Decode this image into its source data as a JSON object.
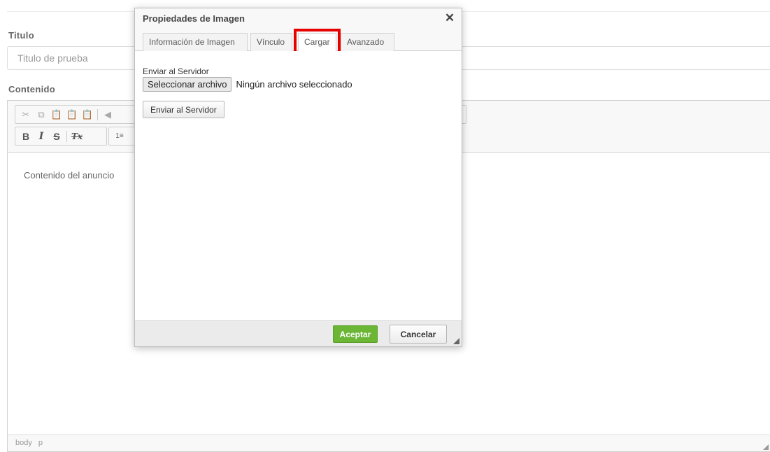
{
  "form": {
    "title_label": "Titulo",
    "title_value": "Titulo de prueba",
    "content_label": "Contenido"
  },
  "editor": {
    "toolbar_row1": [
      "cut-icon",
      "copy-icon",
      "paste-icon",
      "paste-text-icon",
      "paste-word-icon",
      "undo-icon"
    ],
    "toolbar_row2": {
      "bold": "B",
      "italic": "I",
      "strike": "S",
      "remove_format": "Tx",
      "numbered_list": "1≡"
    },
    "placeholder": "Contenido del anuncio",
    "status_path": [
      "body",
      "p"
    ]
  },
  "dialog": {
    "title": "Propiedades de Imagen",
    "close_glyph": "✕",
    "tabs": [
      {
        "label": "Información de Imagen"
      },
      {
        "label": "Vínculo"
      },
      {
        "label": "Cargar",
        "active": true,
        "highlighted": true
      },
      {
        "label": "Avanzado"
      }
    ],
    "upload": {
      "field_label": "Enviar al Servidor",
      "choose_button": "Seleccionar archivo",
      "no_file_text": "Ningún archivo seleccionado",
      "send_button": "Enviar al Servidor"
    },
    "ok_button": "Aceptar",
    "cancel_button": "Cancelar"
  },
  "colors": {
    "accent_ok": "#6cb636",
    "highlight": "#e60000"
  }
}
